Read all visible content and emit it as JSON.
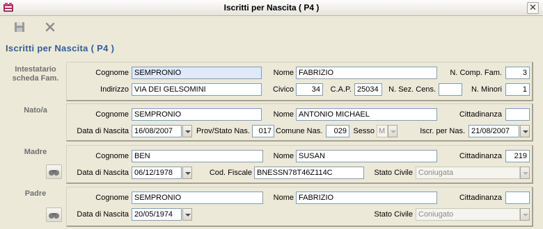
{
  "window": {
    "title": "Iscritti per Nascita ( P4 )",
    "close_glyph": "✕"
  },
  "toolbar": {
    "save_icon": "floppy-save-icon",
    "cancel_icon": "cancel-x-icon"
  },
  "form": {
    "title": "Iscritti per Nascita ( P4 )"
  },
  "intestatario": {
    "section_label_line1": "Intestatario",
    "section_label_line2": "scheda Fam.",
    "cognome_label": "Cognome",
    "cognome": "SEMPRONIO",
    "nome_label": "Nome",
    "nome": "FABRIZIO",
    "n_comp_fam_label": "N. Comp. Fam.",
    "n_comp_fam": "3",
    "indirizzo_label": "Indirizzo",
    "indirizzo": "VIA DEI GELSOMINI",
    "civico_label": "Civico",
    "civico": "34",
    "cap_label": "C.A.P.",
    "cap": "25034",
    "n_sez_cens_label": "N. Sez. Cens.",
    "n_sez_cens": "",
    "n_minori_label": "N. Minori",
    "n_minori": "1"
  },
  "nato": {
    "section_label": "Nato/a",
    "cognome_label": "Cognome",
    "cognome": "SEMPRONIO",
    "nome_label": "Nome",
    "nome": "ANTONIO MICHAEL",
    "cittadinanza_label": "Cittadinanza",
    "cittadinanza": "",
    "data_nascita_label": "Data di Nascita",
    "data_nascita": "16/08/2007",
    "prov_stato_label": "Prov/Stato Nas.",
    "prov_stato": "017",
    "comune_label": "Comune Nas.",
    "comune": "029",
    "sesso_label": "Sesso",
    "sesso": "M",
    "iscr_label": "Iscr. per Nas.",
    "iscr": "21/08/2007"
  },
  "madre": {
    "section_label": "Madre",
    "cognome_label": "Cognome",
    "cognome": "BEN",
    "nome_label": "Nome",
    "nome": "SUSAN",
    "cittadinanza_label": "Cittadinanza",
    "cittadinanza": "219",
    "data_nascita_label": "Data di Nascita",
    "data_nascita": "06/12/1978",
    "cod_fiscale_label": "Cod. Fiscale",
    "cod_fiscale": "BNESSN78T46Z114C",
    "stato_civile_label": "Stato Civile",
    "stato_civile": "Coniugata"
  },
  "padre": {
    "section_label": "Padre",
    "cognome_label": "Cognome",
    "cognome": "SEMPRONIO",
    "nome_label": "Nome",
    "nome": "FABRIZIO",
    "cittadinanza_label": "Cittadinanza",
    "cittadinanza": "",
    "data_nascita_label": "Data di Nascita",
    "data_nascita": "20/05/1974",
    "stato_civile_label": "Stato Civile",
    "stato_civile": "Coniugato"
  }
}
